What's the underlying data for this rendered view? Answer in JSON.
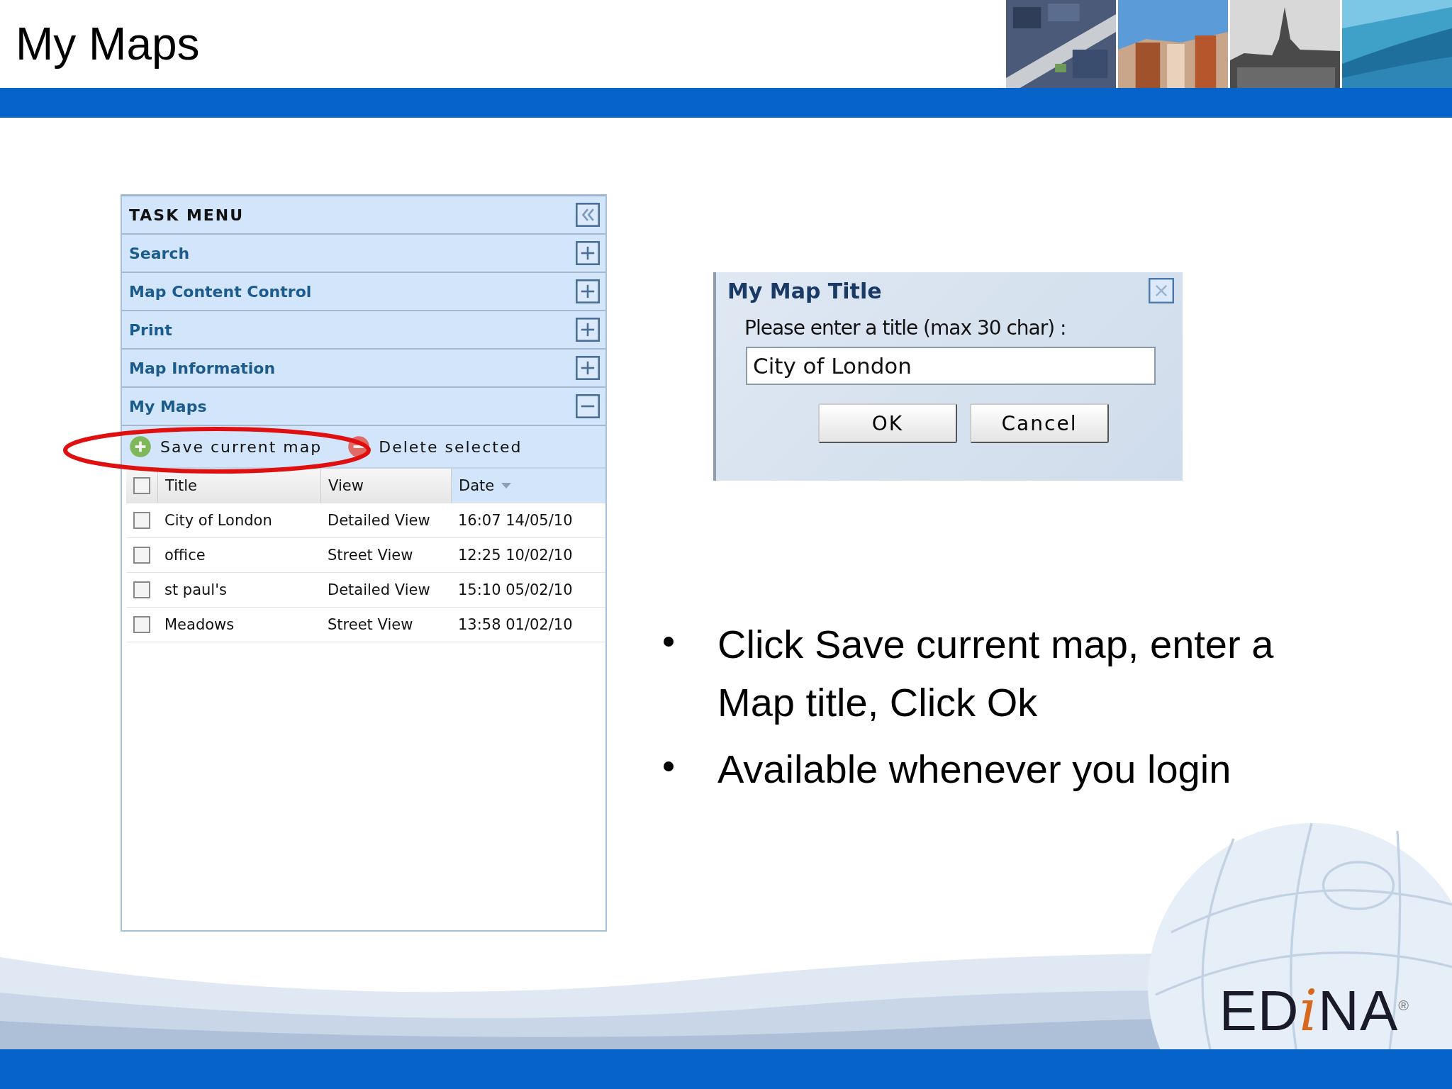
{
  "slide_title": "My Maps",
  "banner_pictures": [
    {
      "kind": "picture"
    },
    {
      "kind": "picture"
    },
    {
      "kind": "picture"
    },
    {
      "kind": "picture"
    }
  ],
  "task_menu": {
    "title": "TASK MENU",
    "sections": [
      {
        "label": "Search",
        "expanded": false
      },
      {
        "label": "Map Content Control",
        "expanded": false
      },
      {
        "label": "Print",
        "expanded": false
      },
      {
        "label": "Map Information",
        "expanded": false
      },
      {
        "label": "My Maps",
        "expanded": true
      }
    ],
    "toolbar": [
      {
        "kind": "add",
        "label": "Save current map"
      },
      {
        "kind": "remove",
        "label": "Delete selected"
      }
    ],
    "table": {
      "columns": [
        {
          "label": "Title",
          "sorted": false
        },
        {
          "label": "View",
          "sorted": false
        },
        {
          "label": "Date",
          "sorted": true
        }
      ],
      "header_checked": false,
      "rows": [
        {
          "checked": false,
          "cells": [
            "City of London",
            "Detailed View",
            "16:07 14/05/10"
          ]
        },
        {
          "checked": false,
          "cells": [
            "office",
            "Street View",
            "12:25 10/02/10"
          ]
        },
        {
          "checked": false,
          "cells": [
            "st paul's",
            "Detailed View",
            "15:10 05/02/10"
          ]
        },
        {
          "checked": false,
          "cells": [
            "Meadows",
            "Street View",
            "13:58 01/02/10"
          ]
        }
      ]
    }
  },
  "dialog": {
    "title": "My Map Title",
    "prompt": "Please enter a title (max 30 char) :",
    "value": "City of London",
    "buttons": [
      "OK",
      "Cancel"
    ]
  },
  "bullets": [
    "Click Save current map, enter a Map title, Click Ok",
    "Available whenever you login"
  ],
  "logo": {
    "prefix": "ED",
    "accent": "i",
    "suffix": "NA",
    "mark": "®"
  }
}
